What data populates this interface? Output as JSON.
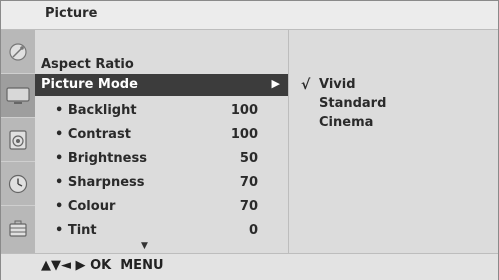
{
  "header": {
    "title": "Picture"
  },
  "sidebar": {
    "icons": [
      {
        "name": "satellite-dish-icon"
      },
      {
        "name": "tv-screen-icon"
      },
      {
        "name": "speaker-icon"
      },
      {
        "name": "clock-icon"
      },
      {
        "name": "lock-icon"
      }
    ]
  },
  "menu": {
    "items": [
      {
        "label": "Aspect Ratio",
        "value": ""
      },
      {
        "label": "Picture Mode",
        "value": "",
        "selected": true
      },
      {
        "label": "• Backlight",
        "value": "100"
      },
      {
        "label": "• Contrast",
        "value": "100"
      },
      {
        "label": "• Brightness",
        "value": "50"
      },
      {
        "label": "• Sharpness",
        "value": "70"
      },
      {
        "label": "• Colour",
        "value": "70"
      },
      {
        "label": "• Tint",
        "value": "0"
      }
    ],
    "selected_arrow": "▶",
    "scroll_down": "▼"
  },
  "submenu": {
    "check": "√",
    "options": [
      {
        "label": "Vivid",
        "checked": true
      },
      {
        "label": "Standard",
        "checked": false
      },
      {
        "label": "Cinema",
        "checked": false
      }
    ]
  },
  "footer": {
    "nav_arrows": "▲▼◄ ▶",
    "ok_label": "OK",
    "menu_label": "MENU"
  }
}
